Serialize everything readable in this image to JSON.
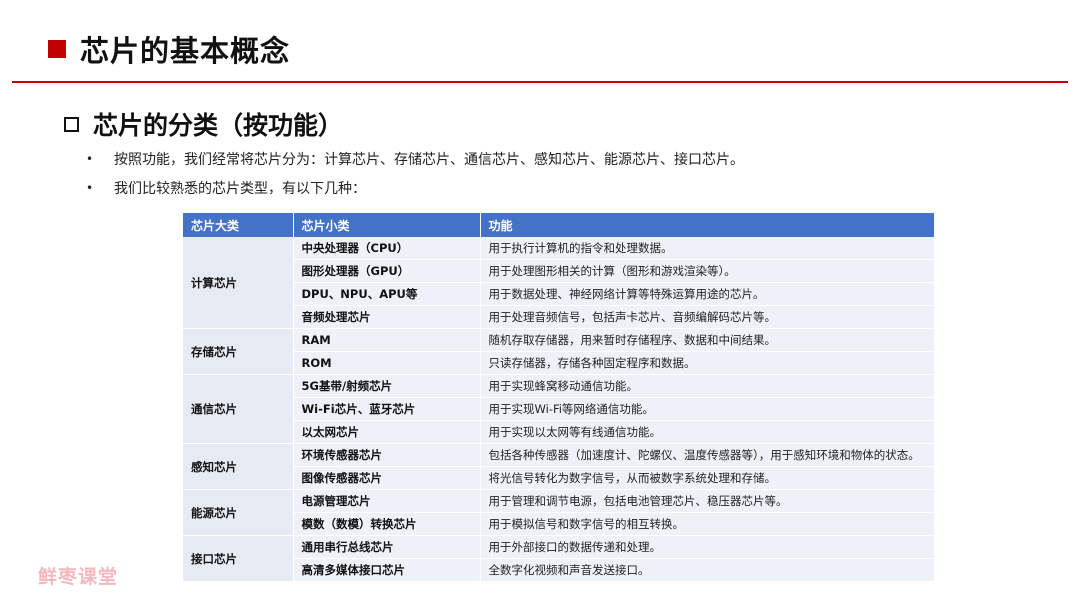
{
  "header": {
    "title": "芯片的基本概念"
  },
  "section": {
    "subtitle": "芯片的分类（按功能）"
  },
  "bullets": [
    "按照功能，我们经常将芯片分为：计算芯片、存储芯片、通信芯片、感知芯片、能源芯片、接口芯片。",
    "我们比较熟悉的芯片类型，有以下几种："
  ],
  "table": {
    "headers": [
      "芯片大类",
      "芯片小类",
      "功能"
    ],
    "groups": [
      {
        "category": "计算芯片",
        "rows": [
          {
            "sub": "中央处理器（CPU）",
            "func": "用于执行计算机的指令和处理数据。"
          },
          {
            "sub": "图形处理器（GPU）",
            "func": "用于处理图形相关的计算（图形和游戏渲染等）。"
          },
          {
            "sub": "DPU、NPU、APU等",
            "func": "用于数据处理、神经网络计算等特殊运算用途的芯片。"
          },
          {
            "sub": "音频处理芯片",
            "func": "用于处理音频信号，包括声卡芯片、音频编解码芯片等。"
          }
        ]
      },
      {
        "category": "存储芯片",
        "rows": [
          {
            "sub": "RAM",
            "func": "随机存取存储器，用来暂时存储程序、数据和中间结果。"
          },
          {
            "sub": "ROM",
            "func": "只读存储器，存储各种固定程序和数据。"
          }
        ]
      },
      {
        "category": "通信芯片",
        "rows": [
          {
            "sub": "5G基带/射频芯片",
            "func": "用于实现蜂窝移动通信功能。"
          },
          {
            "sub": "Wi-Fi芯片、蓝牙芯片",
            "func": "用于实现Wi-Fi等网络通信功能。"
          },
          {
            "sub": "以太网芯片",
            "func": "用于实现以太网等有线通信功能。"
          }
        ]
      },
      {
        "category": "感知芯片",
        "rows": [
          {
            "sub": "环境传感器芯片",
            "func": "包括各种传感器（加速度计、陀螺仪、温度传感器等），用于感知环境和物体的状态。"
          },
          {
            "sub": "图像传感器芯片",
            "func": "将光信号转化为数字信号，从而被数字系统处理和存储。"
          }
        ]
      },
      {
        "category": "能源芯片",
        "rows": [
          {
            "sub": "电源管理芯片",
            "func": "用于管理和调节电源，包括电池管理芯片、稳压器芯片等。"
          },
          {
            "sub": "模数（数模）转换芯片",
            "func": "用于模拟信号和数字信号的相互转换。"
          }
        ]
      },
      {
        "category": "接口芯片",
        "rows": [
          {
            "sub": "通用串行总线芯片",
            "func": "用于外部接口的数据传递和处理。"
          },
          {
            "sub": "高清多媒体接口芯片",
            "func": "全数字化视频和声音发送接口。"
          }
        ]
      }
    ]
  },
  "watermark": "鲜枣课堂",
  "colors": {
    "accent": "#c00000",
    "table_header": "#4472c4",
    "table_row": "#eef1f7",
    "watermark": "#f5b8bf"
  }
}
